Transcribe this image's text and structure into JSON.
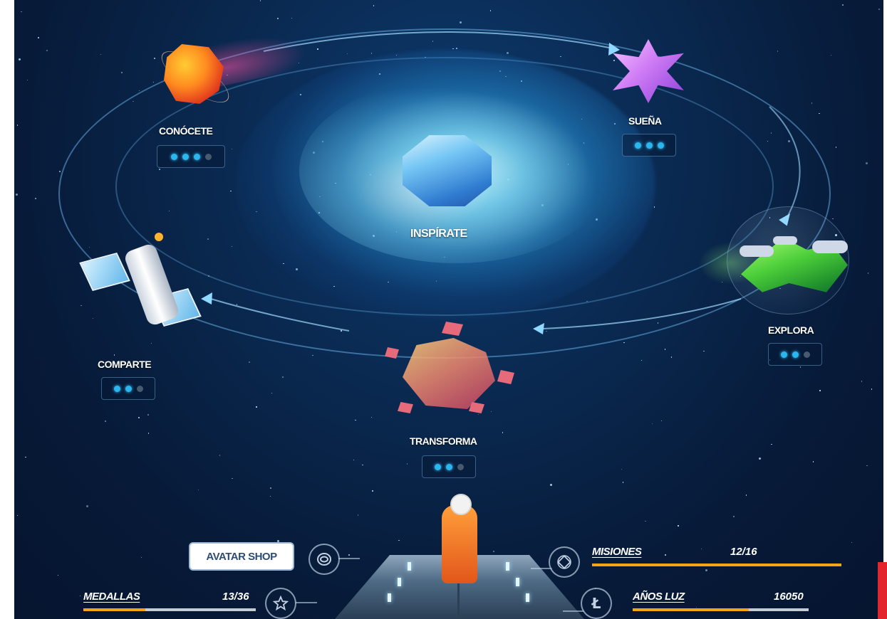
{
  "nodes": {
    "center": {
      "label": "INSPÍRATE"
    },
    "conocete": {
      "label": "CONÓCETE",
      "progress": [
        true,
        true,
        true,
        false
      ]
    },
    "suena": {
      "label": "SUEÑA",
      "progress": [
        true,
        true,
        true
      ]
    },
    "explora": {
      "label": "EXPLORA",
      "progress": [
        true,
        true,
        false
      ]
    },
    "transforma": {
      "label": "TRANSFORMA",
      "progress": [
        true,
        true,
        false
      ]
    },
    "comparte": {
      "label": "COMPARTE",
      "progress": [
        true,
        true,
        false
      ]
    }
  },
  "hud": {
    "avatar_shop_label": "AVATAR SHOP",
    "medallas": {
      "label": "MEDALLAS",
      "value": "13/36",
      "fraction": 0.36
    },
    "misiones": {
      "label": "MISIONES",
      "value": "12/16",
      "fraction": 1.0
    },
    "anos_luz": {
      "label": "AÑOS LUZ",
      "value": "16050",
      "fraction": 0.66
    }
  },
  "icons": {
    "avatar": "avatar-helmet-icon",
    "medallas": "star-badge-icon",
    "misiones": "diamond-compass-icon",
    "anos_luz": "lightyear-coin-icon"
  },
  "colors": {
    "accent_dot": "#2ab6ee",
    "bar_fill": "#f2a516",
    "bar_track": "#c4ccd6"
  }
}
